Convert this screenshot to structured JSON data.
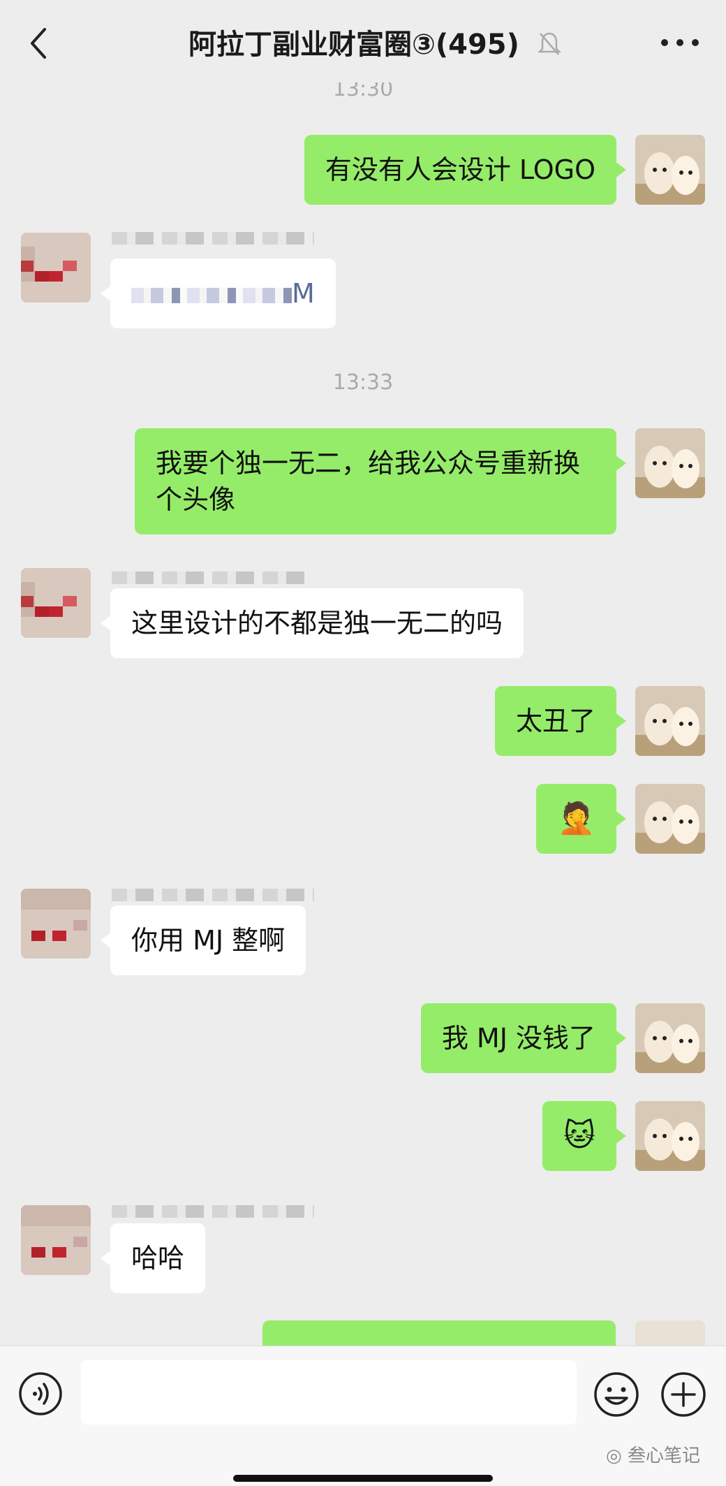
{
  "header": {
    "title": "阿拉丁副业财富圈③(495)",
    "back_icon": "chevron-left-icon",
    "mute_icon": "bell-muted-icon",
    "more_icon": "ellipsis-icon"
  },
  "messages": {
    "time1": "13:30",
    "m1": "有没有人会设计 LOGO",
    "m2_tail": "M",
    "time2": "13:33",
    "m3": "我要个独一无二，给我公众号重新换个头像",
    "m4": "这里设计的不都是独一无二的吗",
    "m5": "太丑了",
    "m6": "🤦",
    "m7": "你用 MJ 整啊",
    "m8": "我 MJ 没钱了",
    "m9": "🐱",
    "m10": "哈哈"
  },
  "input_bar": {
    "voice_icon": "voice-icon",
    "emoji_icon": "emoji-icon",
    "plus_icon": "plus-circle-icon",
    "watermark": "叁心笔记"
  },
  "colors": {
    "my_bubble": "#95ec69",
    "other_bubble": "#ffffff",
    "background": "#ededed"
  }
}
